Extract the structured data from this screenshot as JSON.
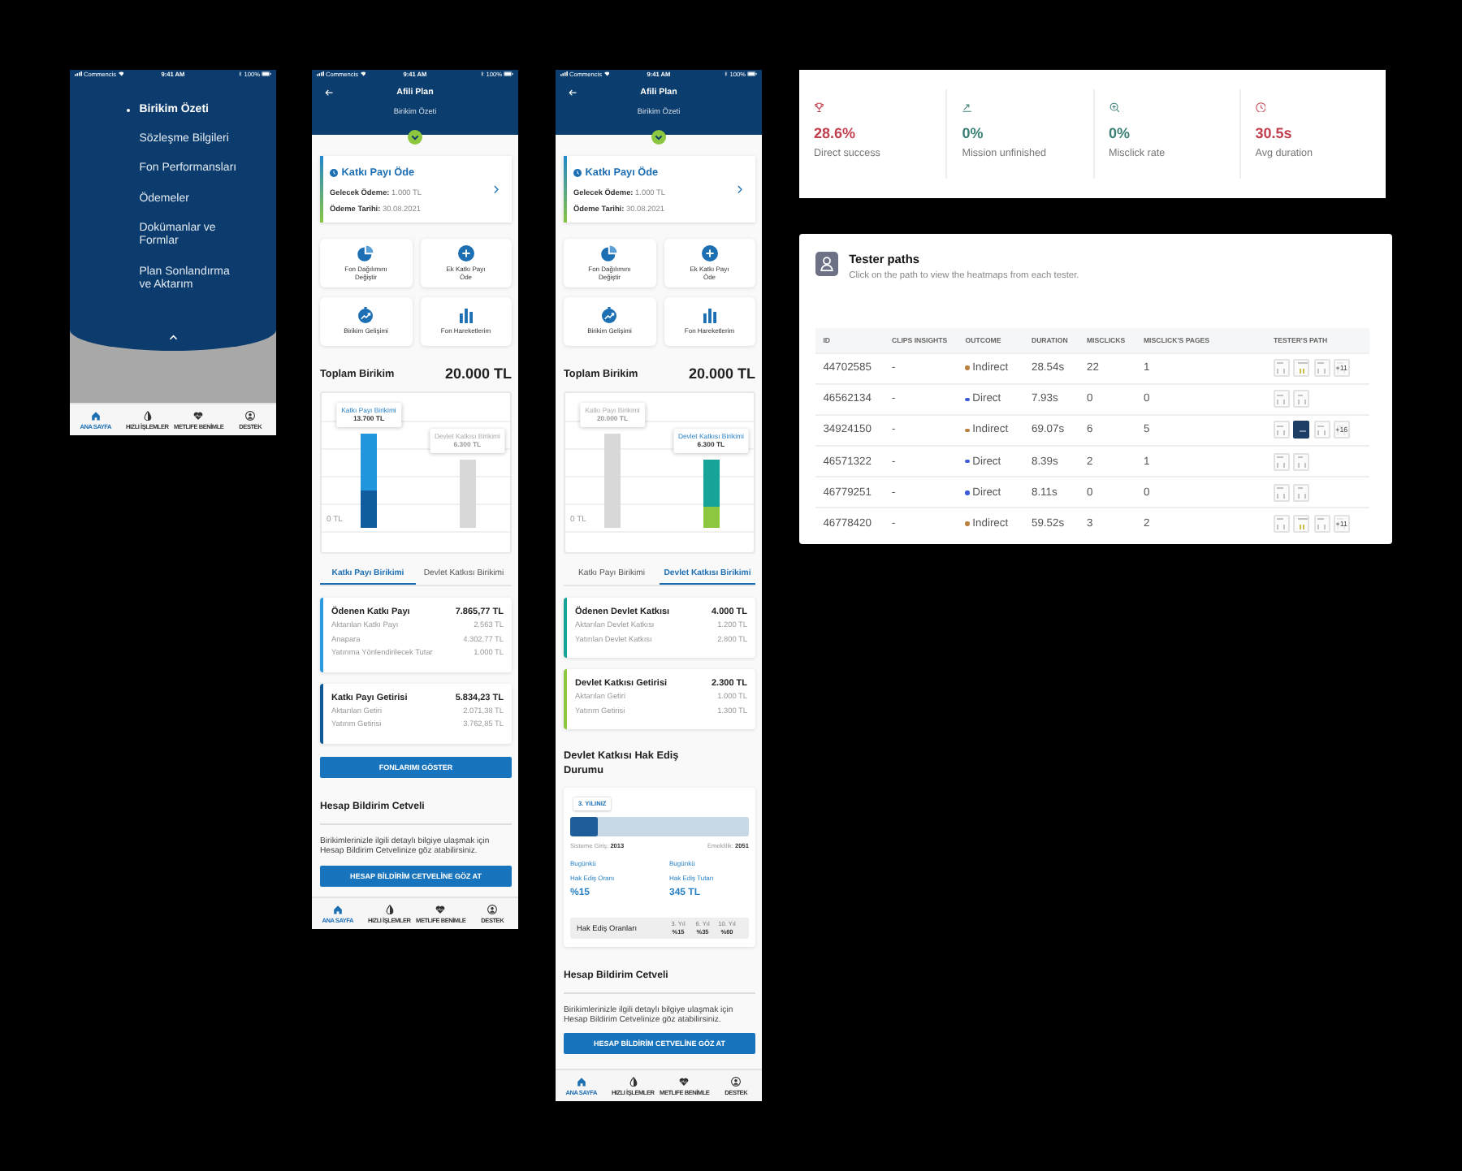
{
  "menu_screen": {
    "status_bar": {
      "carrier": "Commencis",
      "time": "9:41 AM",
      "battery": "100%"
    },
    "menu_items": [
      {
        "label": "Birikim Özeti",
        "selected": true
      },
      {
        "label": "Sözleşme Bilgileri",
        "selected": false
      },
      {
        "label": "Fon Performansları",
        "selected": false
      },
      {
        "label": "Ödemeler",
        "selected": false
      },
      {
        "label": "Dokümanlar ve Formlar",
        "selected": false
      },
      {
        "label": "Plan Sonlandırma ve Aktarım",
        "selected": false
      }
    ],
    "tab_bar": [
      {
        "kind": "home",
        "label": "ANA SAYFA",
        "selected": true
      },
      {
        "kind": "quick",
        "label": "HIZLI İŞLEMLER",
        "selected": false
      },
      {
        "kind": "heart",
        "label": "METLIFE BENİMLE",
        "selected": false
      },
      {
        "kind": "support",
        "label": "DESTEK",
        "selected": false
      }
    ]
  },
  "plan_screens": [
    {
      "status_bar": {
        "carrier": "Commencis",
        "time": "9:41 AM",
        "battery": "100%"
      },
      "header": {
        "title": "Afili Plan",
        "subtitle": "Birikim Özeti"
      },
      "payment_card": {
        "title": "Katkı Payı Öde",
        "lines": [
          {
            "label": "Gelecek Ödeme:",
            "value": "1.000 TL"
          },
          {
            "label": "Ödeme Tarihi:",
            "value": "30.08.2021"
          }
        ]
      },
      "quick_actions": [
        {
          "kind": "pie",
          "label": "Fon Dağılımını Değiştir"
        },
        {
          "kind": "plus",
          "label": "Ek Katkı Payı Öde"
        },
        {
          "kind": "growth",
          "label": "Birikim Gelişimi"
        },
        {
          "kind": "bars",
          "label": "Fon Hareketlerim"
        }
      ],
      "total": {
        "label": "Toplam Birikim",
        "value": "20.000 TL"
      },
      "chart": {
        "axis_label": "0 TL",
        "bars": [
          {
            "label": "Katkı Payı Birikimi",
            "value": "13.700 TL",
            "selected": true
          },
          {
            "label": "Devlet Katkısı Birikimi",
            "value": "6.300 TL",
            "selected": false
          }
        ]
      },
      "tabs": [
        {
          "label": "Katkı Payı Birikimi",
          "selected": true
        },
        {
          "label": "Devlet Katkısı Birikimi",
          "selected": false
        }
      ],
      "breakdown_cards": [
        {
          "color": "#2a9be0",
          "title": "Ödenen Katkı Payı",
          "total": "7.865,77 TL",
          "rows": [
            {
              "label": "Aktarılan Katkı Payı",
              "value": "2.563 TL"
            },
            {
              "label": "Anapara",
              "value": "4.302,77 TL"
            },
            {
              "label": "Yatırıma Yönlendirilecek Tutar",
              "value": "1.000 TL"
            }
          ]
        },
        {
          "color": "#0f5a96",
          "title": "Katkı Payı Getirisi",
          "total": "5.834,23 TL",
          "rows": [
            {
              "label": "Aktarılan Getiri",
              "value": "2.071,38 TL"
            },
            {
              "label": "Yatırım Getirisi",
              "value": "3.762,85 TL"
            }
          ]
        }
      ],
      "fund_button": "FONLARIMI GÖSTER",
      "statement": {
        "title": "Hesap Bildirim Cetveli",
        "text": "Birikimlerinizle ilgili detaylı bilgiye ulaşmak için Hesap Bildirim Cetvelinize göz atabilirsiniz.",
        "button": "HESAP BİLDİRİM CETVELİNE GÖZ AT"
      },
      "tab_bar": [
        {
          "kind": "home",
          "label": "ANA SAYFA",
          "selected": true
        },
        {
          "kind": "quick",
          "label": "HIZLI İŞLEMLER",
          "selected": false
        },
        {
          "kind": "heart",
          "label": "METLIFE BENİMLE",
          "selected": false
        },
        {
          "kind": "support",
          "label": "DESTEK",
          "selected": false
        }
      ]
    },
    {
      "status_bar": {
        "carrier": "Commencis",
        "time": "9:41 AM",
        "battery": "100%"
      },
      "header": {
        "title": "Afili Plan",
        "subtitle": "Birikim Özeti"
      },
      "payment_card": {
        "title": "Katkı Payı Öde",
        "lines": [
          {
            "label": "Gelecek Ödeme:",
            "value": "1.000 TL"
          },
          {
            "label": "Ödeme Tarihi:",
            "value": "30.08.2021"
          }
        ]
      },
      "quick_actions": [
        {
          "kind": "pie",
          "label": "Fon Dağılımını Değiştir"
        },
        {
          "kind": "plus",
          "label": "Ek Katkı Payı Öde"
        },
        {
          "kind": "growth",
          "label": "Birikim Gelişimi"
        },
        {
          "kind": "bars",
          "label": "Fon Hareketlerim"
        }
      ],
      "total": {
        "label": "Toplam Birikim",
        "value": "20.000 TL"
      },
      "chart": {
        "axis_label": "0 TL",
        "bars": [
          {
            "label": "Katkı Payı Birikimi",
            "value": "20.000 TL",
            "selected": false
          },
          {
            "label": "Devlet Katkısı Birikimi",
            "value": "6.300 TL",
            "selected": true
          }
        ]
      },
      "tabs": [
        {
          "label": "Katkı Payı Birikimi",
          "selected": false
        },
        {
          "label": "Devlet Katkısı Birikimi",
          "selected": true
        }
      ],
      "breakdown_cards": [
        {
          "color": "#17a398",
          "title": "Ödenen Devlet Katkısı",
          "total": "4.000 TL",
          "rows": [
            {
              "label": "Aktarılan Devlet Katkısı",
              "value": "1.200 TL"
            },
            {
              "label": "Yatırılan Devlet Katkısı",
              "value": "2.800 TL"
            }
          ]
        },
        {
          "color": "#8dc63f",
          "title": "Devlet Katkısı Getirisi",
          "total": "2.300 TL",
          "rows": [
            {
              "label": "Aktarılan Getiri",
              "value": "1.000 TL"
            },
            {
              "label": "Yatırım Getirisi",
              "value": "1.300 TL"
            }
          ]
        }
      ],
      "vesting": {
        "title": "Devlet Katkısı Hak Ediş Durumu",
        "badge": "3. YILINIZ",
        "level": 0.15,
        "start": {
          "label": "Sisteme Giriş:",
          "value": "2013"
        },
        "end": {
          "label": "Emeklilik:",
          "value": "2051"
        },
        "figures": [
          {
            "label": "Bugünkü\nHak Ediş Oranı",
            "value": "%15"
          },
          {
            "label": "Bugünkü\nHak Ediş Tutarı",
            "value": "345 TL"
          }
        ],
        "rates": {
          "label": "Hak Ediş Oranları",
          "columns": [
            {
              "year": "3. Yıl",
              "rate": "%15"
            },
            {
              "year": "6. Yıl",
              "rate": "%35"
            },
            {
              "year": "10. Yıl",
              "rate": "%60"
            }
          ]
        }
      },
      "statement": {
        "title": "Hesap Bildirim Cetveli",
        "text": "Birikimlerinizle ilgili detaylı bilgiye ulaşmak için Hesap Bildirim Cetvelinize göz atabilirsiniz.",
        "button": "HESAP BİLDİRİM CETVELİNE GÖZ AT"
      },
      "tab_bar": [
        {
          "kind": "home",
          "label": "ANA SAYFA",
          "selected": true
        },
        {
          "kind": "quick",
          "label": "HIZLI İŞLEMLER",
          "selected": false
        },
        {
          "kind": "heart",
          "label": "METLIFE BENİMLE",
          "selected": false
        },
        {
          "kind": "support",
          "label": "DESTEK",
          "selected": false
        }
      ]
    }
  ],
  "metrics_panel": {
    "metrics": [
      {
        "kind": "success",
        "color": "#c24150",
        "value": "28.6%",
        "label": "Direct success"
      },
      {
        "kind": "unfinished",
        "color": "#3b8077",
        "value": "0%",
        "label": "Mission unfinished"
      },
      {
        "kind": "misclick",
        "color": "#3b8077",
        "value": "0%",
        "label": "Misclick rate"
      },
      {
        "kind": "duration",
        "color": "#c24150",
        "value": "30.5s",
        "label": "Avg duration"
      }
    ]
  },
  "tester_paths": {
    "title": "Tester paths",
    "subtitle": "Click on the path to view the heatmaps from each tester.",
    "columns": [
      "ID",
      "CLIPS INSIGHTS",
      "OUTCOME",
      "DURATION",
      "MISCLICKS",
      "MISCLICK'S PAGES",
      "TESTER'S PATH"
    ],
    "rows": [
      {
        "id": "44702585",
        "clips": "-",
        "outcome": {
          "label": "Indirect",
          "color": "#b9803f"
        },
        "duration": "28.54s",
        "misclicks": "22",
        "misclick_pages": "1",
        "path": [
          {
            "kind": "screen"
          },
          {
            "kind": "chart"
          },
          {
            "kind": "screen"
          },
          {
            "kind": "screen",
            "more": "+11"
          }
        ]
      },
      {
        "id": "46562134",
        "clips": "-",
        "outcome": {
          "label": "Direct",
          "color": "#3d5bd9"
        },
        "duration": "7.93s",
        "misclicks": "0",
        "misclick_pages": "0",
        "path": [
          {
            "kind": "screen"
          },
          {
            "kind": "screen"
          }
        ]
      },
      {
        "id": "34924150",
        "clips": "-",
        "outcome": {
          "label": "Indirect",
          "color": "#b9803f"
        },
        "duration": "69.07s",
        "misclicks": "6",
        "misclick_pages": "5",
        "path": [
          {
            "kind": "screen"
          },
          {
            "kind": "dark"
          },
          {
            "kind": "screen"
          },
          {
            "kind": "screen",
            "more": "+16"
          }
        ]
      },
      {
        "id": "46571322",
        "clips": "-",
        "outcome": {
          "label": "Direct",
          "color": "#3d5bd9"
        },
        "duration": "8.39s",
        "misclicks": "2",
        "misclick_pages": "1",
        "path": [
          {
            "kind": "screen"
          },
          {
            "kind": "screen"
          }
        ]
      },
      {
        "id": "46779251",
        "clips": "-",
        "outcome": {
          "label": "Direct",
          "color": "#3d5bd9"
        },
        "duration": "8.11s",
        "misclicks": "0",
        "misclick_pages": "0",
        "path": [
          {
            "kind": "screen"
          },
          {
            "kind": "screen"
          }
        ]
      },
      {
        "id": "46778420",
        "clips": "-",
        "outcome": {
          "label": "Indirect",
          "color": "#b9803f"
        },
        "duration": "59.52s",
        "misclicks": "3",
        "misclick_pages": "2",
        "path": [
          {
            "kind": "screen"
          },
          {
            "kind": "chart"
          },
          {
            "kind": "screen"
          },
          {
            "kind": "screen",
            "more": "+11"
          }
        ]
      }
    ]
  }
}
